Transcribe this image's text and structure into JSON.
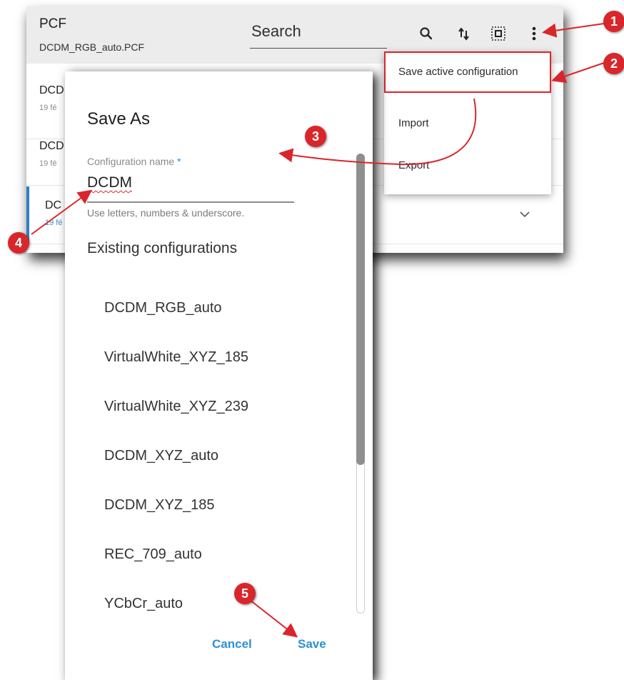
{
  "app": {
    "title": "PCF",
    "subtitle": "DCDM_RGB_auto.PCF",
    "search_placeholder": "Search",
    "toolbar_icons": [
      "search-icon",
      "sort-icon",
      "select-all-icon",
      "more-vert-icon"
    ]
  },
  "list": {
    "items": [
      {
        "title": "DCD",
        "date": "19 fé"
      },
      {
        "title": "DCD",
        "date": "19 fé"
      },
      {
        "title": "DC",
        "date": "19 fé",
        "active": true
      }
    ]
  },
  "menu": {
    "items": [
      "Save active configuration",
      "Import",
      "Export"
    ]
  },
  "dialog": {
    "title": "Save As",
    "field_label": "Configuration name",
    "required_mark": "*",
    "field_value": "DCDM",
    "field_hint": "Use letters, numbers & underscore.",
    "section_heading": "Existing configurations",
    "configurations": [
      "DCDM_RGB_auto",
      "VirtualWhite_XYZ_185",
      "VirtualWhite_XYZ_239",
      "DCDM_XYZ_auto",
      "DCDM_XYZ_185",
      "REC_709_auto",
      "YCbCr_auto"
    ],
    "cancel_label": "Cancel",
    "save_label": "Save"
  },
  "callouts": [
    "1",
    "2",
    "3",
    "4",
    "5"
  ],
  "colors": {
    "accent": "#2d8fd5",
    "annotation_red": "#d9262b",
    "header_bg": "#ececec"
  }
}
